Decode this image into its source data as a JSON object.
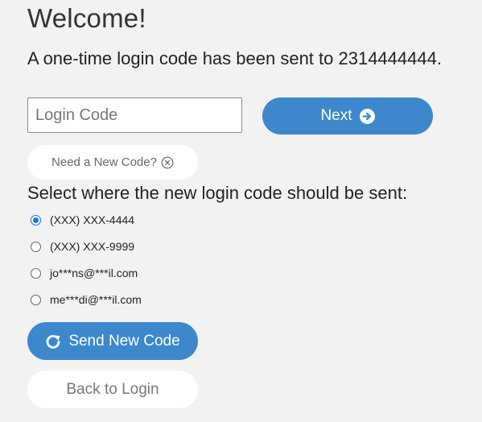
{
  "header": {
    "title": "Welcome!",
    "subtitle": "A one-time login code has been sent to 2314444444."
  },
  "login_code": {
    "placeholder": "Login Code",
    "value": ""
  },
  "buttons": {
    "next_label": "Next",
    "need_new_code_label": "Need a New Code?",
    "send_new_code_label": "Send New Code",
    "back_to_login_label": "Back to Login"
  },
  "delivery": {
    "prompt": "Select where the new login code should be sent:",
    "selected_index": 0,
    "options": [
      {
        "label": "(XXX) XXX-4444",
        "checked": true
      },
      {
        "label": "(XXX) XXX-9999",
        "checked": false
      },
      {
        "label": "jo***ns@***il.com",
        "checked": false
      },
      {
        "label": "me***di@***il.com",
        "checked": false
      }
    ]
  },
  "icons": {
    "next": "arrow-circle-right-icon",
    "need_new_code": "close-circle-icon",
    "send_new_code": "refresh-icon"
  },
  "colors": {
    "primary": "#3d88cc",
    "background": "#f2f2f2",
    "radio_selected": "#1a73e8"
  }
}
